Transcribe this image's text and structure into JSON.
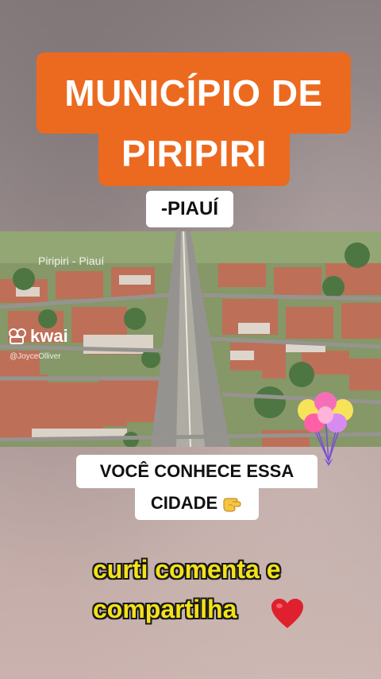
{
  "title": {
    "line1": "MUNICÍPIO DE",
    "line2": "PIRIPIRI"
  },
  "subtitle": "-PIAUÍ",
  "photo": {
    "caption": "Piripiri - Piauí",
    "watermark_logo": "kwai",
    "watermark_handle": "@JoyceOlliver"
  },
  "question": {
    "line1": "VOCÊ CONHECE ESSA",
    "line2": "CIDADE"
  },
  "cta": {
    "line1": "curti comenta e",
    "line2": "compartilha"
  },
  "icons": {
    "question_icon": "pointing-hand-icon",
    "cta_icon": "heart-icon",
    "decoration": "balloons-icon"
  },
  "colors": {
    "title_bg": "#ec6a1f",
    "cta_text": "#f4e21a",
    "heart": "#e0202e"
  }
}
